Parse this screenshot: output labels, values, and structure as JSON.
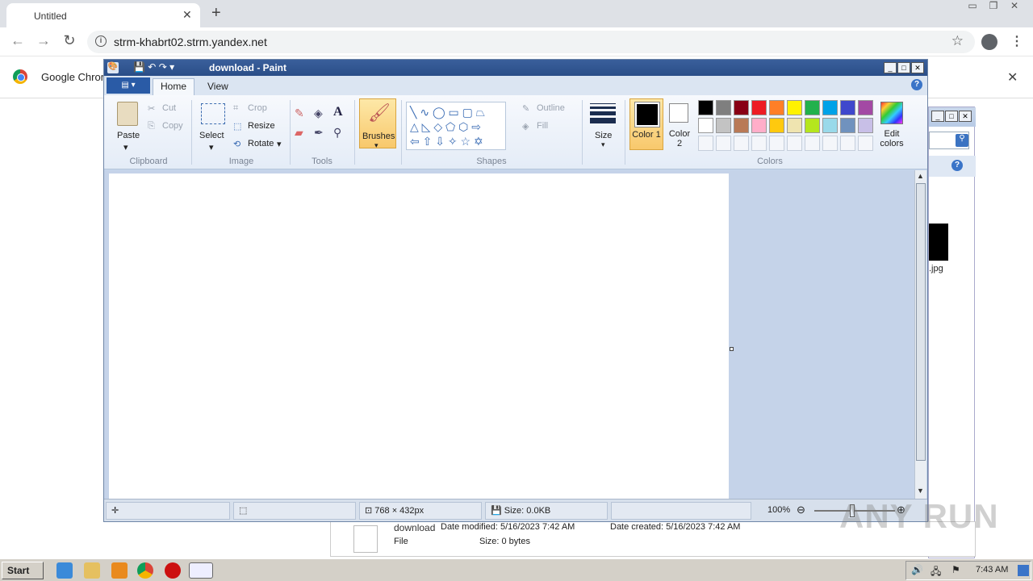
{
  "browser": {
    "tab_title": "Untitled",
    "url": "strm-khabrt02.strm.yandex.net",
    "bookmark_text": "Google Chrom"
  },
  "explorer": {
    "file_label": ".jpg",
    "details": {
      "name": "download",
      "date_modified": "Date modified: 5/16/2023 7:42 AM",
      "date_created": "Date created: 5/16/2023 7:42 AM",
      "type": "File",
      "size": "Size: 0 bytes"
    }
  },
  "paint": {
    "title": "download - Paint",
    "tabs": [
      "Home",
      "View"
    ],
    "clipboard": {
      "paste": "Paste",
      "cut": "Cut",
      "copy": "Copy",
      "group": "Clipboard"
    },
    "image": {
      "select": "Select",
      "crop": "Crop",
      "resize": "Resize",
      "rotate": "Rotate",
      "group": "Image"
    },
    "tools": {
      "group": "Tools"
    },
    "brushes": "Brushes",
    "shapes": {
      "outline": "Outline",
      "fill": "Fill",
      "group": "Shapes"
    },
    "size": "Size",
    "colors": {
      "color1": "Color 1",
      "color2": "Color 2",
      "edit": "Edit colors",
      "group": "Colors",
      "row1": [
        "#000000",
        "#7f7f7f",
        "#880015",
        "#ed1c24",
        "#ff7f27",
        "#fff200",
        "#22b14c",
        "#00a2e8",
        "#3f48cc",
        "#a349a4"
      ],
      "row2": [
        "#ffffff",
        "#c3c3c3",
        "#b97a57",
        "#ffaec9",
        "#ffc90e",
        "#efe4b0",
        "#b5e61d",
        "#99d9ea",
        "#7092be",
        "#c8bfe7"
      ]
    },
    "status": {
      "dimensions": "768 × 432px",
      "filesize": "Size: 0.0KB",
      "zoom": "100%"
    }
  },
  "taskbar": {
    "start": "Start",
    "clock": "7:43 AM"
  },
  "watermark": "ANY RUN"
}
